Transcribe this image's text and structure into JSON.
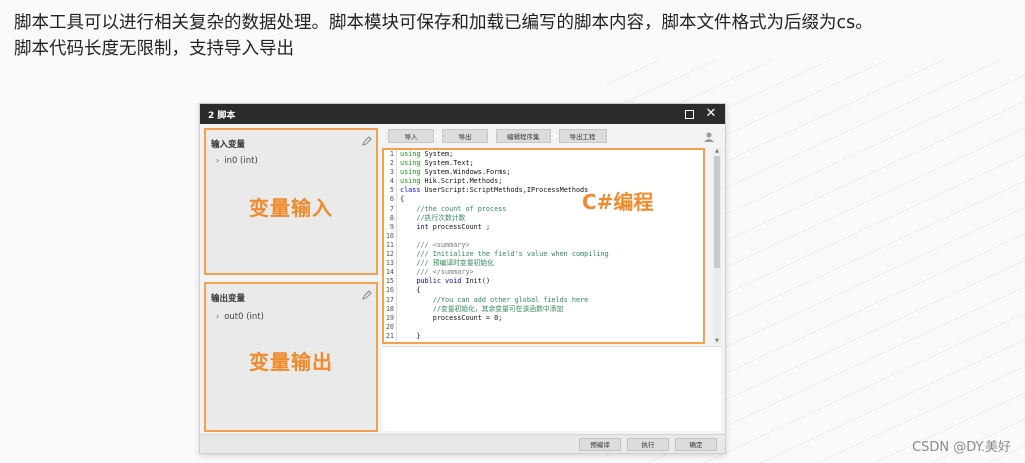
{
  "caption": {
    "line1": "脚本工具可以进行相关复杂的数据处理。脚本模块可保存和加载已编写的脚本内容，脚本文件格式为后缀为cs。",
    "line2": "脚本代码长度无限制，支持导入导出"
  },
  "dialog": {
    "title": "2 脚本",
    "input_panel": {
      "title": "输入变量",
      "item": "in0 (int)",
      "annotation": "变量输入"
    },
    "output_panel": {
      "title": "输出变量",
      "item": "out0 (int)",
      "annotation": "变量输出"
    },
    "toolbar": {
      "import": "导入",
      "export": "导出",
      "edit_assembly": "编辑程序集",
      "export_project": "导出工程"
    },
    "code_annotation": "C#编程",
    "code_lines": [
      {
        "n": "1",
        "parts": [
          [
            "kw-g",
            "using"
          ],
          [
            "tx",
            " System;"
          ]
        ]
      },
      {
        "n": "2",
        "parts": [
          [
            "kw-g",
            "using"
          ],
          [
            "tx",
            " System.Text;"
          ]
        ]
      },
      {
        "n": "3",
        "parts": [
          [
            "kw-g",
            "using"
          ],
          [
            "tx",
            " System.Windows.Forms;"
          ]
        ]
      },
      {
        "n": "4",
        "parts": [
          [
            "kw-g",
            "using"
          ],
          [
            "tx",
            " Hik.Script.Methods;"
          ]
        ]
      },
      {
        "n": "5",
        "parts": [
          [
            "kw",
            "class"
          ],
          [
            "tx",
            " UserScript:ScriptMethods,IProcessMethods"
          ]
        ]
      },
      {
        "n": "6",
        "parts": [
          [
            "tx",
            "{"
          ]
        ]
      },
      {
        "n": "7",
        "parts": [
          [
            "cm",
            "    //the count of process"
          ]
        ]
      },
      {
        "n": "8",
        "parts": [
          [
            "cm",
            "    //执行次数计数"
          ]
        ]
      },
      {
        "n": "9",
        "parts": [
          [
            "kw",
            "    int"
          ],
          [
            "tx",
            " processCount ;"
          ]
        ]
      },
      {
        "n": "10",
        "parts": [
          [
            "tx",
            ""
          ]
        ]
      },
      {
        "n": "11",
        "parts": [
          [
            "cm-g",
            "    /// <summary>"
          ]
        ]
      },
      {
        "n": "12",
        "parts": [
          [
            "cm",
            "    /// Initialize the field's value when compiling"
          ]
        ]
      },
      {
        "n": "13",
        "parts": [
          [
            "cm",
            "    /// 预编译时变量初始化"
          ]
        ]
      },
      {
        "n": "14",
        "parts": [
          [
            "cm-g",
            "    /// </summary>"
          ]
        ]
      },
      {
        "n": "15",
        "parts": [
          [
            "kw",
            "    public void"
          ],
          [
            "tx",
            " Init()"
          ]
        ]
      },
      {
        "n": "16",
        "parts": [
          [
            "tx",
            "    {"
          ]
        ]
      },
      {
        "n": "17",
        "parts": [
          [
            "cm",
            "        //You can add other global fields here"
          ]
        ]
      },
      {
        "n": "18",
        "parts": [
          [
            "cm",
            "        //变量初始化，其余变量可在该函数中添加"
          ]
        ]
      },
      {
        "n": "19",
        "parts": [
          [
            "tx",
            "        processCount = 0;"
          ]
        ]
      },
      {
        "n": "20",
        "parts": [
          [
            "tx",
            ""
          ]
        ]
      },
      {
        "n": "21",
        "parts": [
          [
            "tx",
            "    }"
          ]
        ]
      }
    ],
    "footer": {
      "precompile": "预编译",
      "execute": "执行",
      "confirm": "确定"
    }
  },
  "watermark": "CSDN @DY.美好",
  "colors": {
    "accent": "#f08a2a",
    "titlebar": "#2b2b2b"
  },
  "icons": [
    "pencil-icon",
    "user-icon",
    "maximize-icon",
    "close-icon",
    "chevron-right-icon"
  ]
}
